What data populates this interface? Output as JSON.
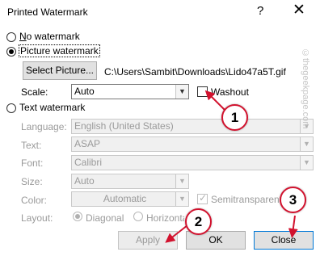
{
  "window": {
    "title": "Printed Watermark",
    "help_glyph": "?",
    "close_glyph": "✕"
  },
  "no_watermark": {
    "label": "No watermark",
    "checked": false
  },
  "picture_watermark": {
    "label": "Picture watermark",
    "checked": true,
    "select_picture_label": "Select Picture...",
    "file_path": "C:\\Users\\Sambit\\Downloads\\Lido47a5T.gif",
    "scale_label": "Scale:",
    "scale_value": "Auto",
    "washout_label": "Washout",
    "washout_checked": false
  },
  "text_watermark": {
    "label": "Text watermark",
    "checked": false,
    "language_label": "Language:",
    "language_value": "English (United States)",
    "text_label": "Text:",
    "text_value": "ASAP",
    "font_label": "Font:",
    "font_value": "Calibri",
    "size_label": "Size:",
    "size_value": "Auto",
    "color_label": "Color:",
    "color_value": "Automatic",
    "semitransparent_label": "Semitransparent",
    "semitransparent_checked": true,
    "layout_label": "Layout:",
    "layout_diagonal": "Diagonal",
    "layout_horizontal": "Horizontal"
  },
  "buttons": {
    "apply": "Apply",
    "ok": "OK",
    "close": "Close"
  },
  "annotations": {
    "one": "1",
    "two": "2",
    "three": "3"
  },
  "side_watermark": "©thegeekpage.com",
  "colors": {
    "annotation_red": "#d2122e",
    "focus_blue": "#0078d7",
    "disabled_gray": "#9a9a9a"
  }
}
